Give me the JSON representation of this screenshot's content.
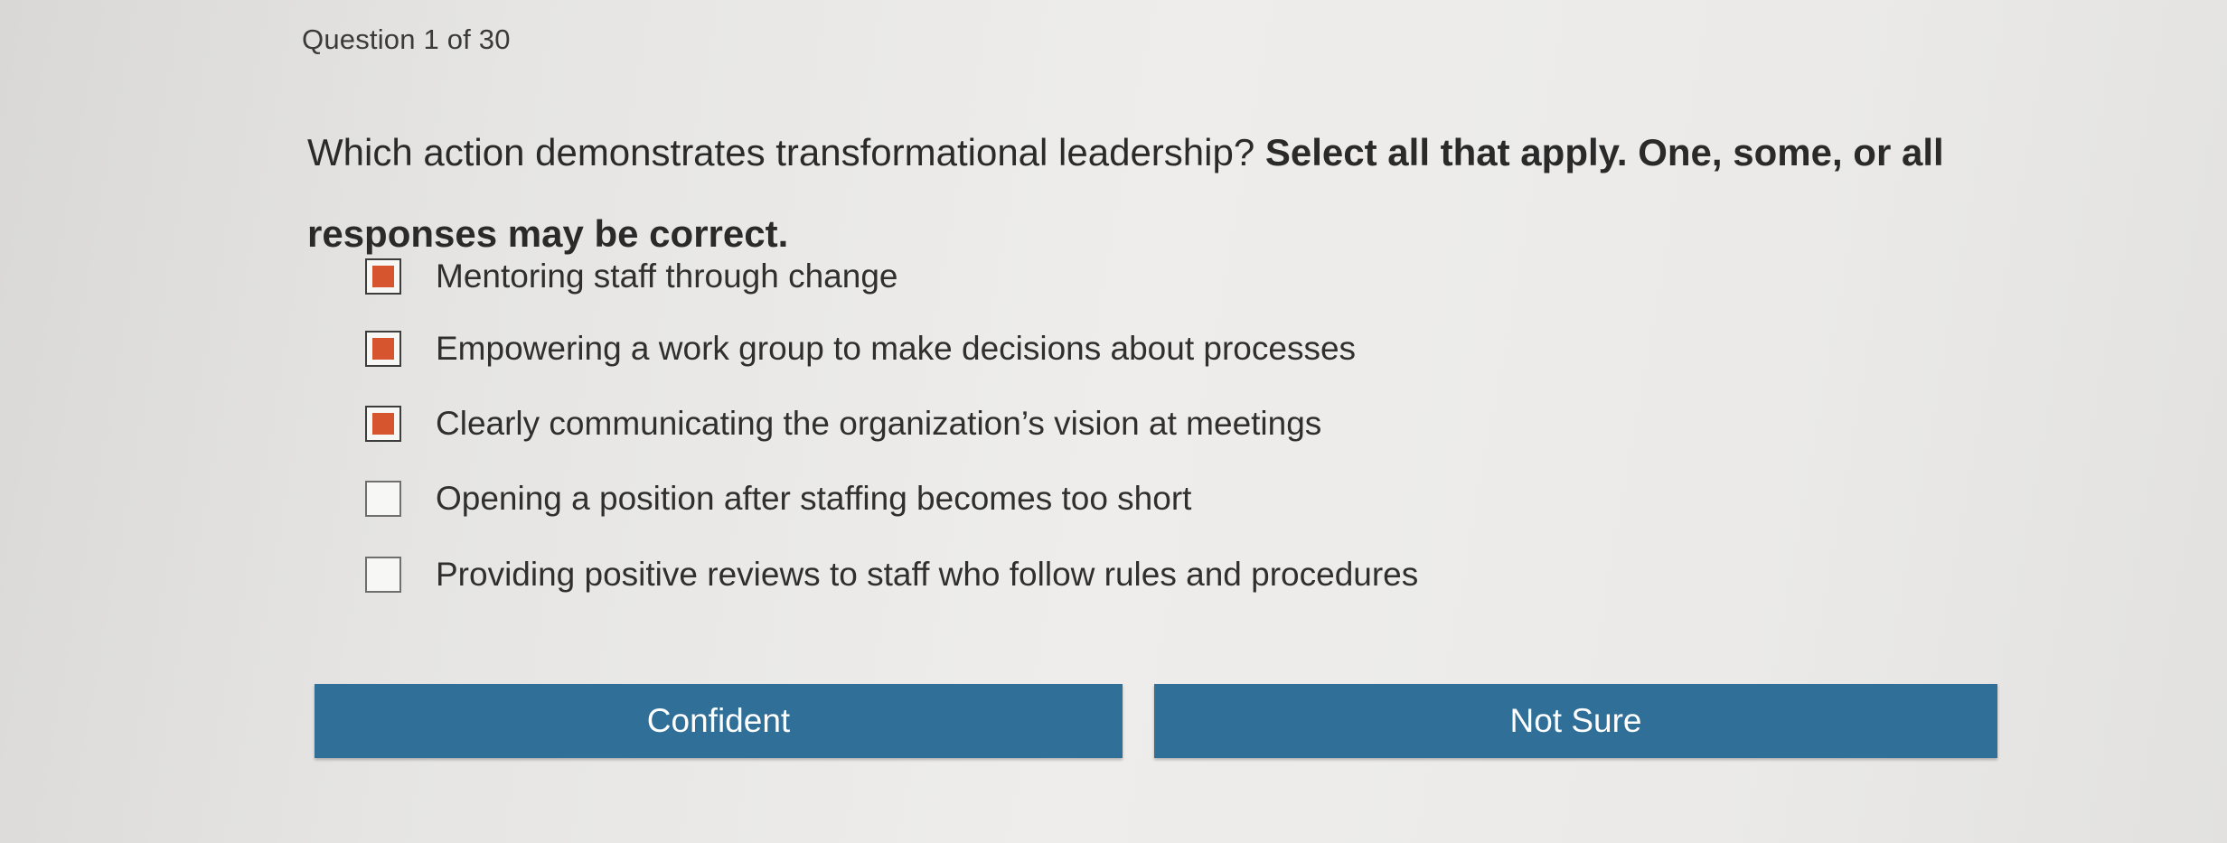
{
  "header": {
    "question_counter": "Question 1 of 30"
  },
  "question": {
    "prompt": "Which action demonstrates transformational leadership? ",
    "instruction": "Select all that apply. One, some, or all responses may be correct."
  },
  "options": [
    {
      "label": "Mentoring staff through change",
      "checked": true
    },
    {
      "label": "Empowering a work group to make decisions about processes",
      "checked": true
    },
    {
      "label": "Clearly communicating the organization’s vision at meetings",
      "checked": true
    },
    {
      "label": "Opening a position after staffing becomes too short",
      "checked": false
    },
    {
      "label": "Providing positive reviews to staff who follow rules and procedures",
      "checked": false
    }
  ],
  "buttons": {
    "confident_label": "Confident",
    "not_sure_label": "Not Sure"
  },
  "colors": {
    "button_bg": "#2f6f98",
    "checkbox_fill": "#d6552e",
    "background": "#e6e5e3"
  }
}
